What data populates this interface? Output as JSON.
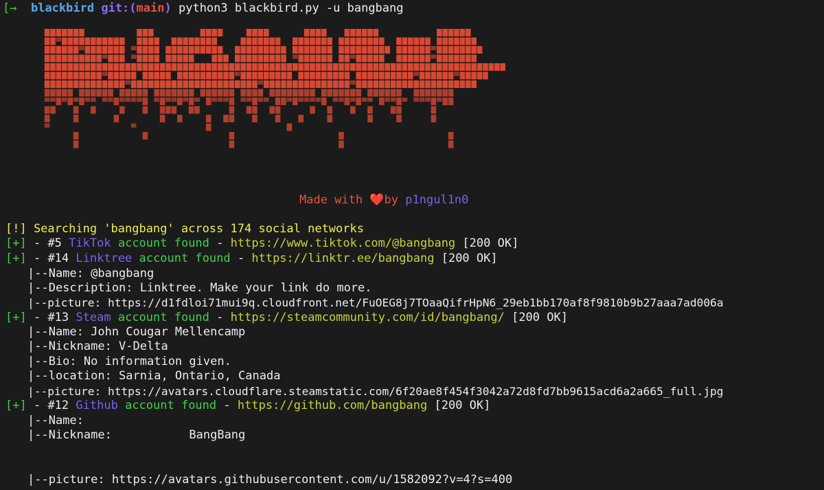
{
  "prompt": {
    "arrow": "[→",
    "dir": "blackbird",
    "git_label": "git:(",
    "branch": "main",
    "git_close": ")",
    "command": "python3 blackbird.py -u bangbang"
  },
  "banner": {
    "art_name": "BLACKBIRD",
    "color": "#e34b34",
    "credit_prefix": "Made with",
    "heart": "❤️",
    "credit_by": "by",
    "author": "p1ngul1n0"
  },
  "output": {
    "search_line": "[!] Searching 'bangbang' across 174 social networks",
    "results": [
      {
        "prefix": "[+]",
        "index": "- #5",
        "site": "TikTok",
        "found": "account found",
        "dash": "-",
        "url": "https://www.tiktok.com/@bangbang",
        "status": "[200 OK]",
        "details": []
      },
      {
        "prefix": "[+]",
        "index": "- #14",
        "site": "Linktree",
        "found": "account found",
        "dash": "-",
        "url": "https://linktr.ee/bangbang",
        "status": "[200 OK]",
        "details": [
          "|--Name: @bangbang",
          "|--Description: Linktree. Make your link do more.",
          "|--picture: https://d1fdloi71mui9q.cloudfront.net/FuOEG8j7TOaaQifrHpN6_29eb1bb170af8f9810b9b27aaa7ad006a"
        ]
      },
      {
        "prefix": "[+]",
        "index": "- #13",
        "site": "Steam",
        "found": "account found",
        "dash": "-",
        "url": "https://steamcommunity.com/id/bangbang/",
        "status": "[200 OK]",
        "details": [
          "|--Name: John Cougar Mellencamp",
          "|--Nickname: V-Delta",
          "|--Bio: No information given.",
          "|--location: Sarnia, Ontario, Canada",
          "|--picture: https://avatars.cloudflare.steamstatic.com/6f20ae8f454f3042a72d8fd7bb9615acd6a2a665_full.jpg"
        ]
      },
      {
        "prefix": "[+]",
        "index": "- #12",
        "site": "Github",
        "found": "account found",
        "dash": "-",
        "url": "https://github.com/bangbang",
        "status": "[200 OK]",
        "details": [
          "|--Name:",
          "|--Nickname:           BangBang",
          "|--picture: https://avatars.githubusercontent.com/u/1582092?v=4?s=400"
        ]
      }
    ]
  }
}
